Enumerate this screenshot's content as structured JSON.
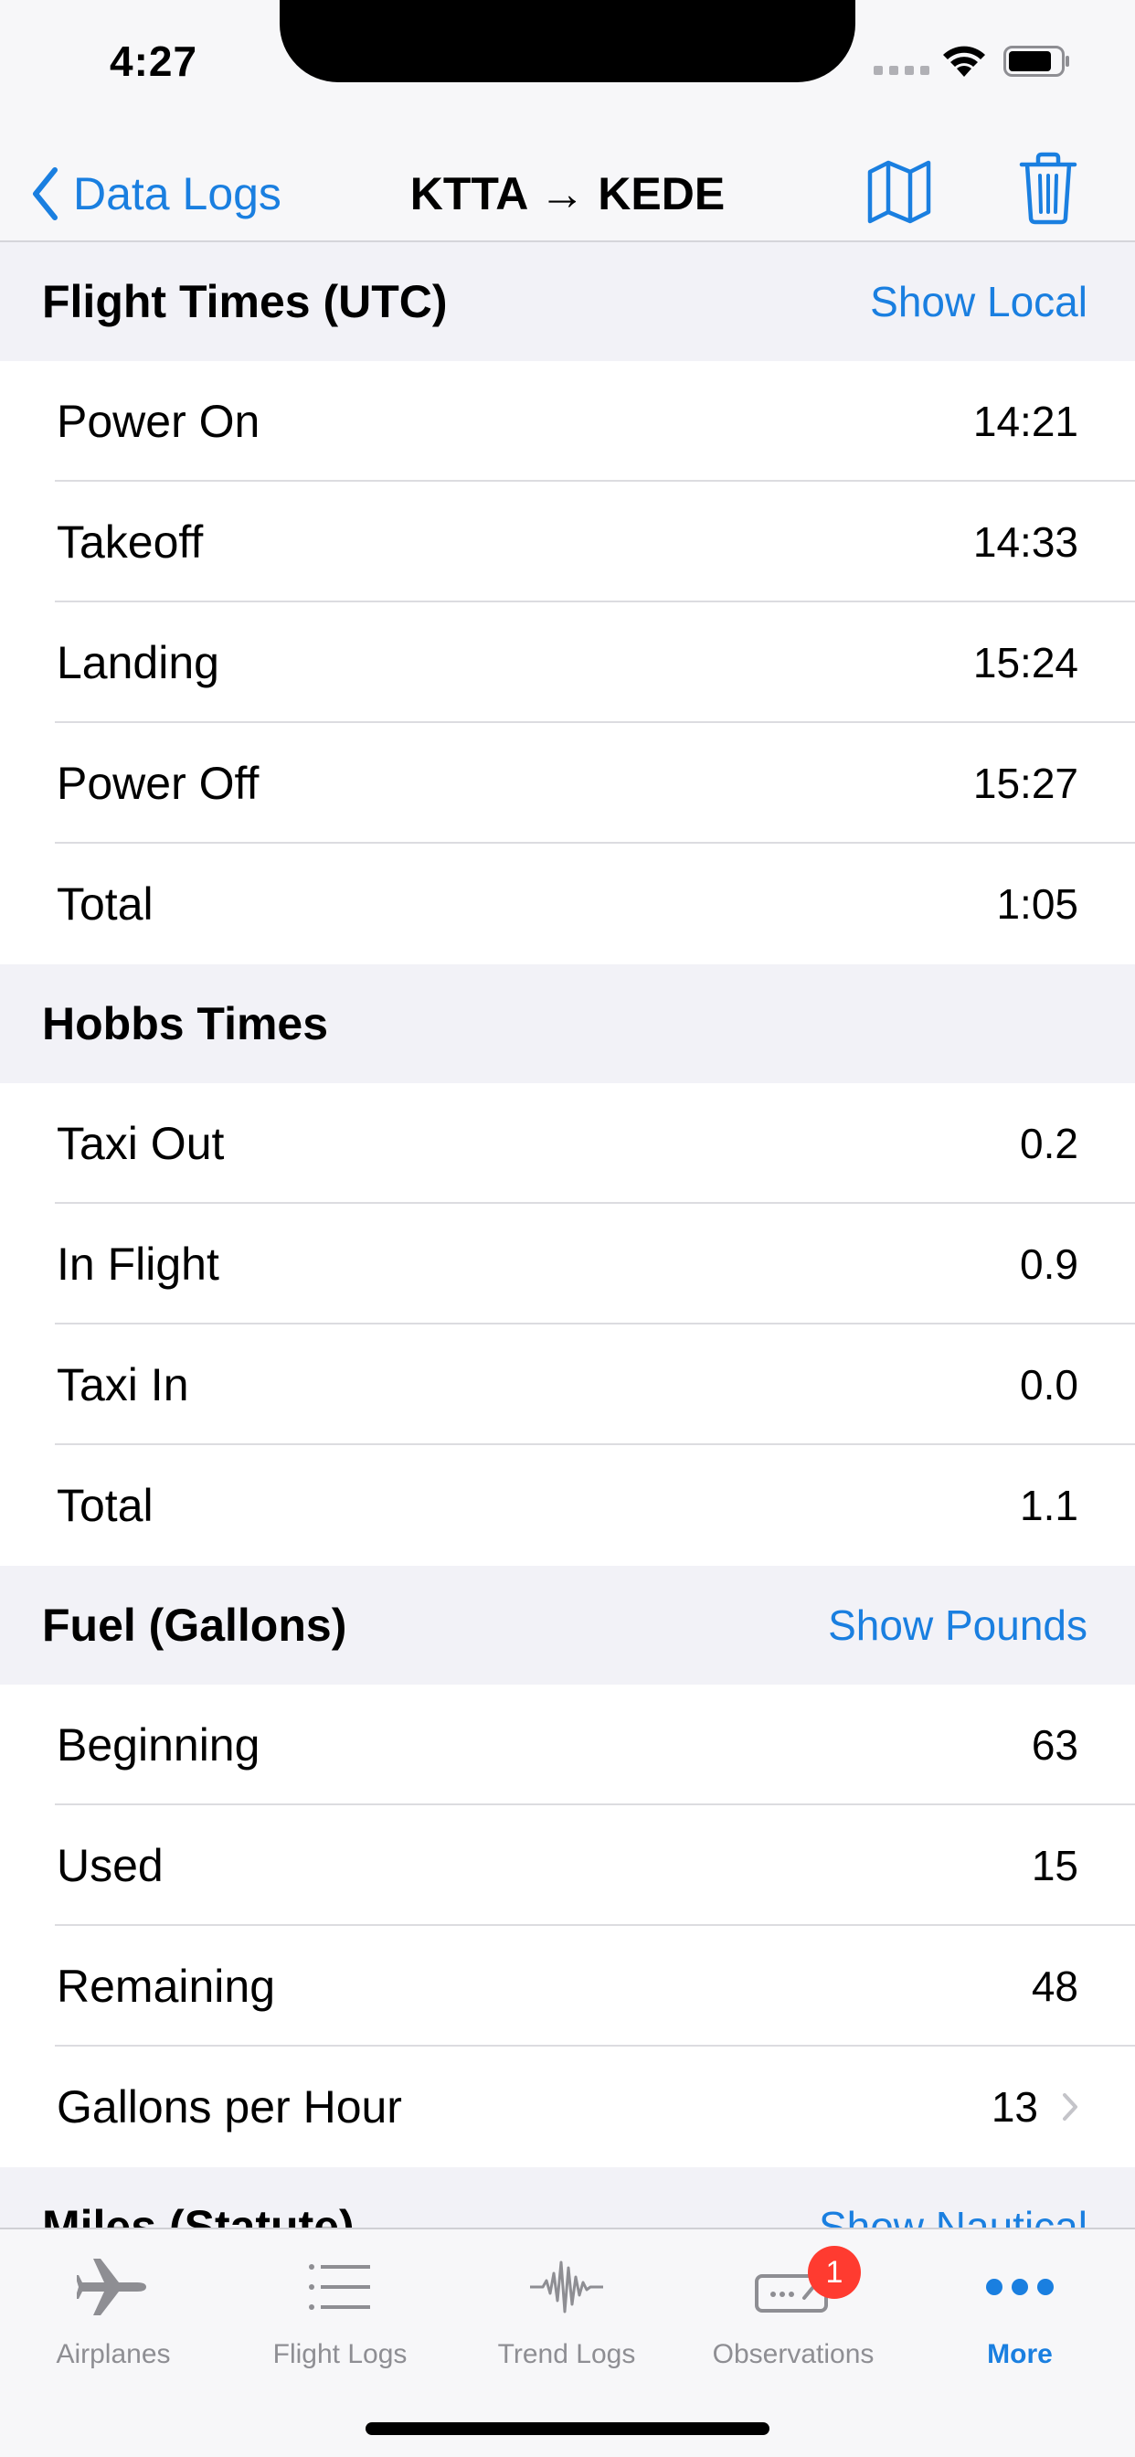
{
  "status": {
    "time": "4:27"
  },
  "nav": {
    "back_label": "Data Logs",
    "title": "KTTA → KEDE"
  },
  "sections": {
    "flight_times": {
      "title": "Flight Times (UTC)",
      "action": "Show Local",
      "rows": [
        {
          "label": "Power On",
          "value": "14:21"
        },
        {
          "label": "Takeoff",
          "value": "14:33"
        },
        {
          "label": "Landing",
          "value": "15:24"
        },
        {
          "label": "Power Off",
          "value": "15:27"
        },
        {
          "label": "Total",
          "value": "1:05"
        }
      ]
    },
    "hobbs": {
      "title": "Hobbs Times",
      "rows": [
        {
          "label": "Taxi Out",
          "value": "0.2"
        },
        {
          "label": "In Flight",
          "value": "0.9"
        },
        {
          "label": "Taxi In",
          "value": "0.0"
        },
        {
          "label": "Total",
          "value": "1.1"
        }
      ]
    },
    "fuel": {
      "title": "Fuel (Gallons)",
      "action": "Show Pounds",
      "rows": [
        {
          "label": "Beginning",
          "value": "63"
        },
        {
          "label": "Used",
          "value": "15"
        },
        {
          "label": "Remaining",
          "value": "48"
        },
        {
          "label": "Gallons per Hour",
          "value": "13"
        }
      ]
    },
    "miles": {
      "title": "Miles (Statute)",
      "action": "Show Nautical"
    }
  },
  "tabs": [
    {
      "label": "Airplanes",
      "icon": "airplane-icon"
    },
    {
      "label": "Flight Logs",
      "icon": "list-icon"
    },
    {
      "label": "Trend Logs",
      "icon": "waveform-icon"
    },
    {
      "label": "Observations",
      "icon": "squawk-icon",
      "badge": "1"
    },
    {
      "label": "More",
      "icon": "more-icon",
      "active": true
    }
  ],
  "colors": {
    "accent": "#1a7fe0",
    "badge": "#ff3b30",
    "group_bg": "#f2f2f7"
  }
}
